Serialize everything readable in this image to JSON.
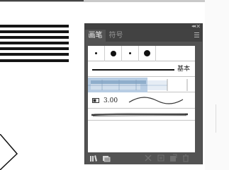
{
  "panel": {
    "tabs": [
      {
        "label": "画笔",
        "active": true
      },
      {
        "label": "符号",
        "active": false
      }
    ],
    "controls": {
      "collapse_icon": "collapse-arrows-icon",
      "close_icon": "close-icon",
      "menu_icon": "panel-menu-icon"
    },
    "brushes": {
      "calligraphic_dots": [
        {
          "size": "small"
        },
        {
          "size": "large"
        },
        {
          "size": "small"
        },
        {
          "size": "large"
        }
      ],
      "basic": {
        "label": "基本"
      },
      "pattern": {
        "name": "pattern-brush"
      },
      "width_brush": {
        "value": "3.00"
      },
      "bristle": {
        "name": "bristle-brush"
      }
    },
    "footer": {
      "icons": [
        "brush-libraries-icon",
        "libraries-panel-icon",
        "remove-brush-stroke-icon",
        "options-icon",
        "new-brush-icon",
        "delete-brush-icon"
      ]
    }
  },
  "colors": {
    "panel_bg": "#535353",
    "tab_bar": "#424242",
    "accent_blue": "#a9bfd9"
  }
}
